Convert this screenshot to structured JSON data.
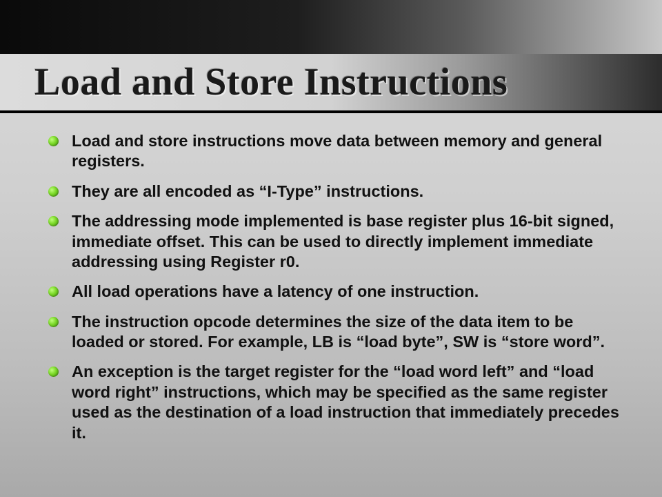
{
  "slide": {
    "title": "Load and Store Instructions",
    "bullets": [
      "Load and store instructions move data between memory and general registers.",
      "They are all encoded as “I-Type” instructions.",
      "The addressing mode implemented is base register plus 16-bit signed, immediate offset.  This can be used to directly implement immediate addressing using Register r0.",
      "All load operations have a latency of one instruction.",
      "The instruction opcode determines the size of the data item to be loaded or stored.  For example, LB is “load byte”, SW is “store word”.",
      "An exception is the target register for the “load word left” and “load word right” instructions, which may be specified as the same register used as the destination of a load instruction that immediately precedes it."
    ]
  }
}
